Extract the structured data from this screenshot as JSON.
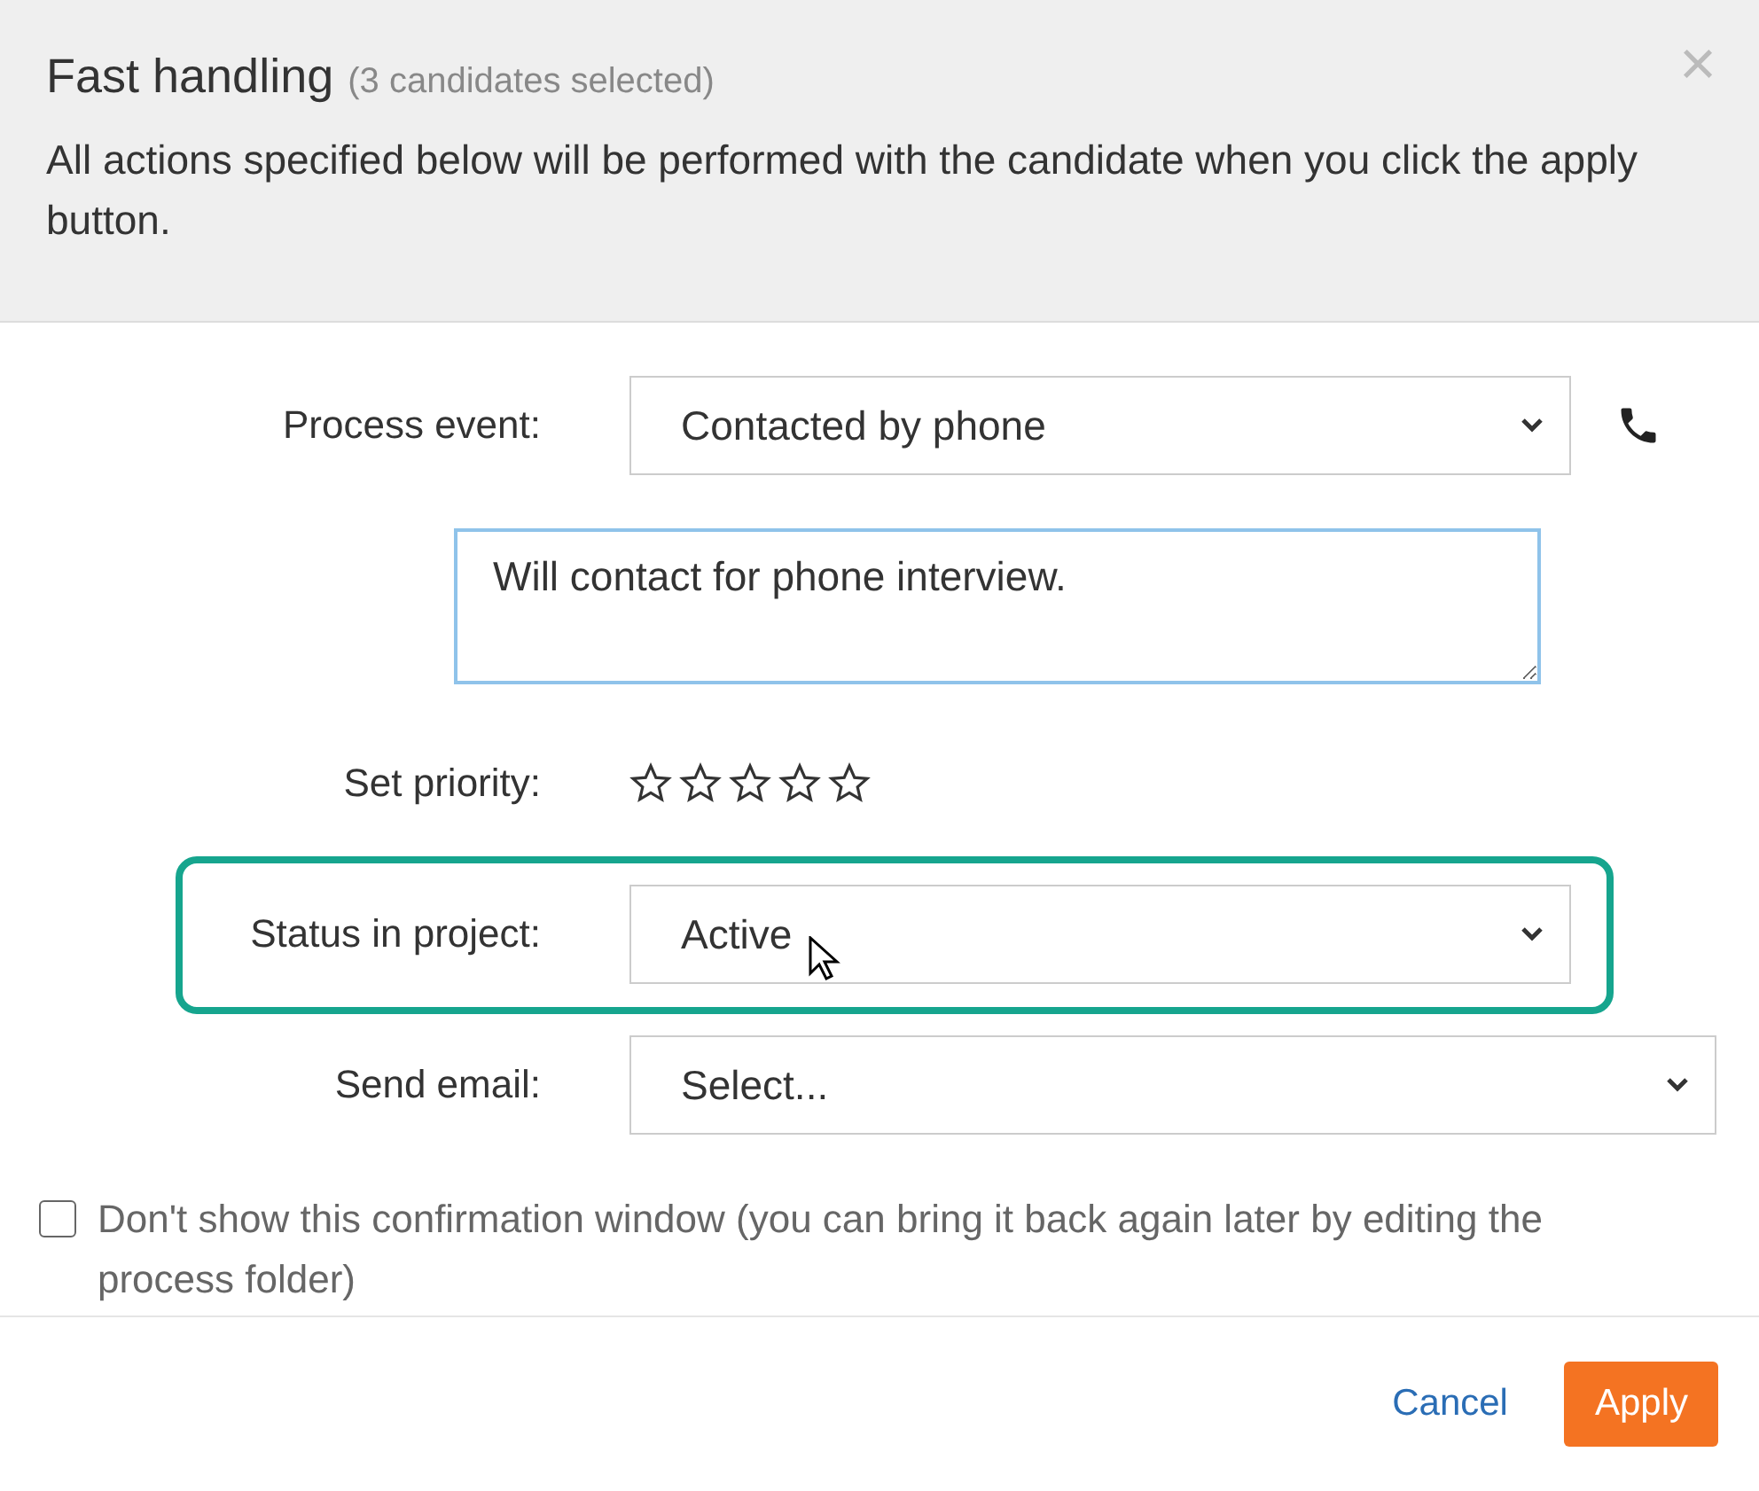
{
  "dialog": {
    "title": "Fast handling",
    "subtitle": "(3 candidates selected)",
    "close": "×",
    "description": "All actions specified below will be performed with the candidate when you click the apply button."
  },
  "fields": [
    {
      "kind": "select",
      "label": "Process event:",
      "value": "Contacted by phone",
      "highlighted": false,
      "wide": false,
      "phone": true
    },
    {
      "kind": "textarea",
      "value": "Will contact for phone interview."
    },
    {
      "kind": "stars",
      "label": "Set priority:",
      "stars": 0
    },
    {
      "kind": "select",
      "label": "Status in project:",
      "value": "Active",
      "highlighted": true,
      "wide": false,
      "phone": false
    },
    {
      "kind": "select",
      "label": "Send email:",
      "value": "Select...",
      "highlighted": false,
      "wide": true,
      "phone": false
    }
  ],
  "confirmation": {
    "label": "Don't show this confirmation window (you can bring it back again later by editing the process folder)",
    "checked": false
  },
  "buttons": [
    {
      "kind": "link",
      "label": "Cancel"
    },
    {
      "kind": "primary",
      "label": "Apply"
    }
  ]
}
